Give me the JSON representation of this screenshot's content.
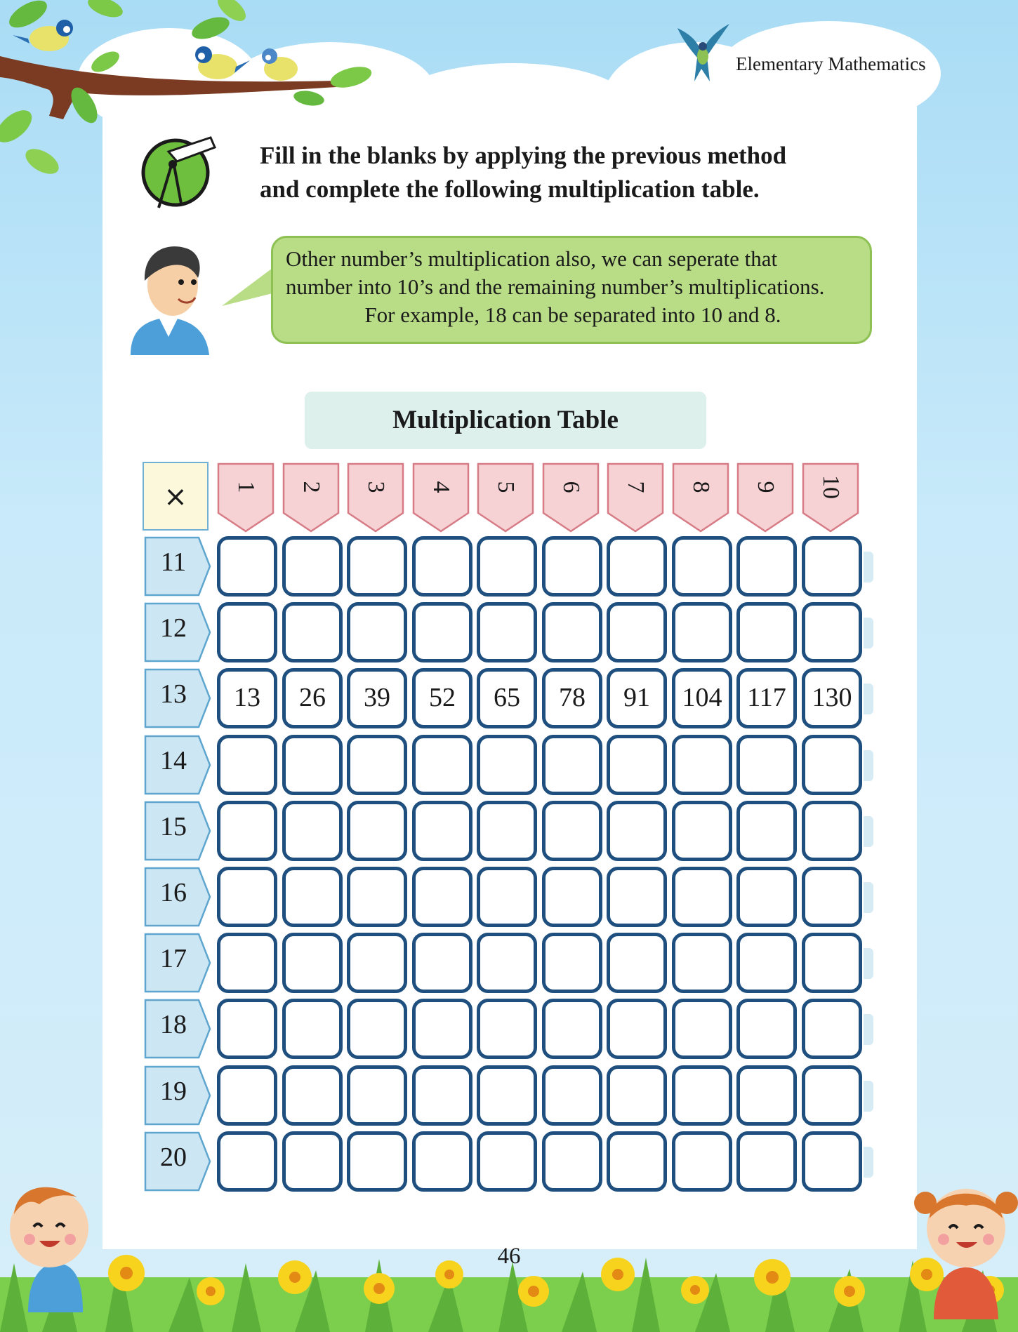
{
  "header": {
    "book_title": "Elementary Mathematics"
  },
  "instruction": {
    "line1": "Fill in the blanks by applying the previous method",
    "line2": "and complete the following multiplication table."
  },
  "speech_bubble": {
    "line1": "Other number’s multiplication also, we can seperate that",
    "line2": "number into 10’s and the remaining number’s multiplications.",
    "line3": "For example, 18 can be separated into 10 and 8."
  },
  "table": {
    "title": "Multiplication Table",
    "corner_symbol": "×",
    "column_headers": [
      "1",
      "2",
      "3",
      "4",
      "5",
      "6",
      "7",
      "8",
      "9",
      "10"
    ],
    "rows": [
      {
        "label": "11",
        "cells": [
          "",
          "",
          "",
          "",
          "",
          "",
          "",
          "",
          "",
          ""
        ]
      },
      {
        "label": "12",
        "cells": [
          "",
          "",
          "",
          "",
          "",
          "",
          "",
          "",
          "",
          ""
        ]
      },
      {
        "label": "13",
        "cells": [
          "13",
          "26",
          "39",
          "52",
          "65",
          "78",
          "91",
          "104",
          "117",
          "130"
        ]
      },
      {
        "label": "14",
        "cells": [
          "",
          "",
          "",
          "",
          "",
          "",
          "",
          "",
          "",
          ""
        ]
      },
      {
        "label": "15",
        "cells": [
          "",
          "",
          "",
          "",
          "",
          "",
          "",
          "",
          "",
          ""
        ]
      },
      {
        "label": "16",
        "cells": [
          "",
          "",
          "",
          "",
          "",
          "",
          "",
          "",
          "",
          ""
        ]
      },
      {
        "label": "17",
        "cells": [
          "",
          "",
          "",
          "",
          "",
          "",
          "",
          "",
          "",
          ""
        ]
      },
      {
        "label": "18",
        "cells": [
          "",
          "",
          "",
          "",
          "",
          "",
          "",
          "",
          "",
          ""
        ]
      },
      {
        "label": "19",
        "cells": [
          "",
          "",
          "",
          "",
          "",
          "",
          "",
          "",
          "",
          ""
        ]
      },
      {
        "label": "20",
        "cells": [
          "",
          "",
          "",
          "",
          "",
          "",
          "",
          "",
          "",
          ""
        ]
      }
    ]
  },
  "page_number": "46",
  "icons": [
    "bird-icon",
    "compass-tool-icon",
    "boy-illustration",
    "girl-illustration",
    "flower-grass-border"
  ],
  "colors": {
    "bubble_fill": "#b9dc87",
    "column_header_fill": "#f6d2d5",
    "row_header_fill": "#cde6f3",
    "cell_border": "#1e4f7e"
  }
}
